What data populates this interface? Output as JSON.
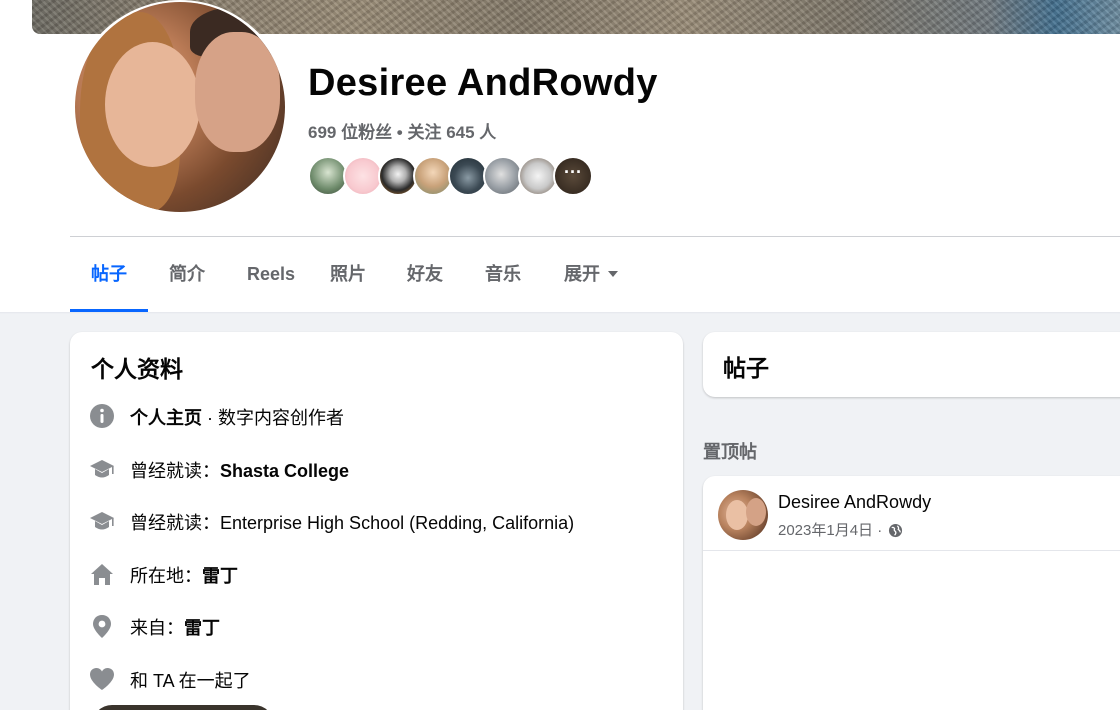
{
  "profile": {
    "name": "Desiree AndRowdy",
    "stats": "699 位粉丝 • 关注 645 人",
    "friend_more": "···"
  },
  "tabs": [
    {
      "label": "帖子",
      "active": true
    },
    {
      "label": "简介"
    },
    {
      "label": "Reels"
    },
    {
      "label": "照片"
    },
    {
      "label": "好友"
    },
    {
      "label": "音乐"
    },
    {
      "label": "展开"
    }
  ],
  "intro": {
    "title": "个人资料",
    "items": [
      {
        "icon": "info-icon",
        "bold": "个人主页",
        "text": " · 数字内容创作者"
      },
      {
        "icon": "graduation-cap-icon",
        "prefix": "曾经就读：",
        "bold": "Shasta College"
      },
      {
        "icon": "graduation-cap-icon",
        "prefix": "曾经就读：",
        "text": "Enterprise High School (Redding, California)"
      },
      {
        "icon": "home-icon",
        "prefix": "所在地：",
        "bold": "雷丁"
      },
      {
        "icon": "location-pin-icon",
        "prefix": "来自：",
        "bold": "雷丁"
      },
      {
        "icon": "heart-icon",
        "text": "和 TA 在一起了"
      }
    ]
  },
  "posts": {
    "title": "帖子",
    "pinned_label": "置顶帖",
    "pinned_post": {
      "author": "Desiree AndRowdy",
      "date": "2023年1月4日 · "
    }
  },
  "colors": {
    "accent": "#0866ff",
    "secondary_text": "#65676b",
    "background": "#f0f2f5",
    "icon_gray": "#8a8d91"
  }
}
